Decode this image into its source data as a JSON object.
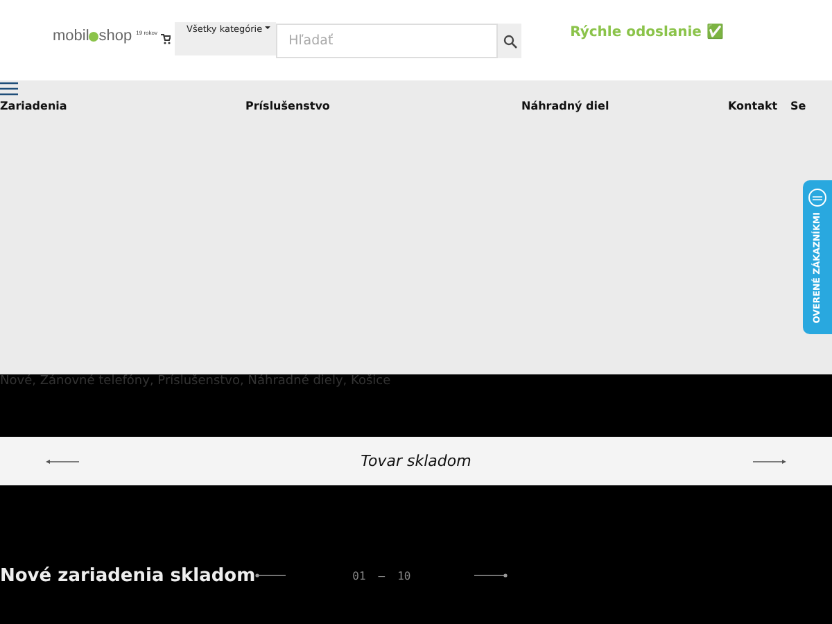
{
  "header": {
    "logo": {
      "left": "mobil",
      "right": "shop",
      "tagline": "19 rokov"
    },
    "category_select": {
      "label": "Všetky kategórie"
    },
    "search": {
      "placeholder": "Hľadať"
    },
    "promo": "Rýchle odoslanie ✅"
  },
  "nav": {
    "items": [
      {
        "label": "Zariadenia"
      },
      {
        "label": "Príslušenstvo"
      },
      {
        "label": "Náhradný diel"
      },
      {
        "label": "Kontakt"
      },
      {
        "label": "Se"
      }
    ]
  },
  "side_tab": {
    "label": "OVERENÉ ZÁKAZNÍKMI"
  },
  "banner": {
    "text": "Nové, Zánovné telefóny, Príslušenstvo, Náhradné diely, Košice"
  },
  "ticker": {
    "label": "Tovar skladom"
  },
  "section": {
    "title": "Nové zariadenia skladom",
    "counter_current": "01",
    "counter_separator": "—",
    "counter_total": "10"
  }
}
